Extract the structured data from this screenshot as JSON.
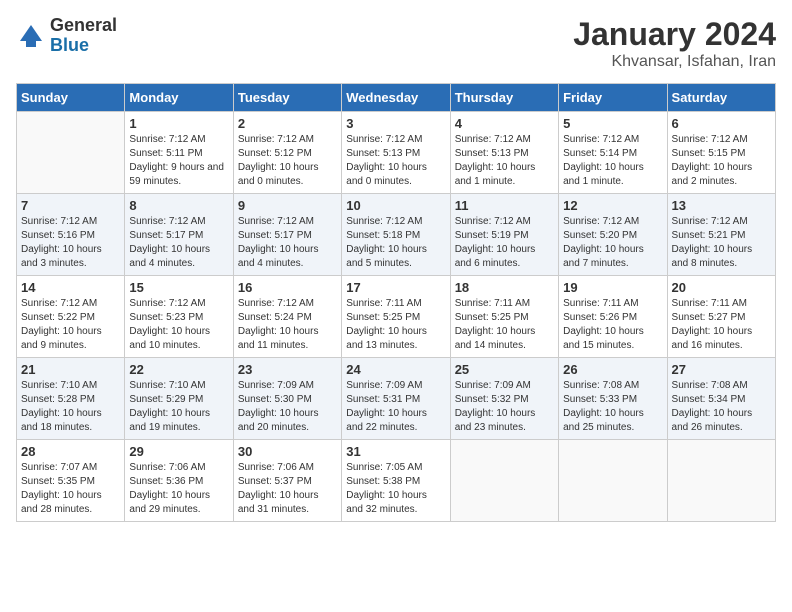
{
  "header": {
    "logo": {
      "line1": "General",
      "line2": "Blue"
    },
    "title": "January 2024",
    "subtitle": "Khvansar, Isfahan, Iran"
  },
  "days_of_week": [
    "Sunday",
    "Monday",
    "Tuesday",
    "Wednesday",
    "Thursday",
    "Friday",
    "Saturday"
  ],
  "weeks": [
    [
      {
        "day": "",
        "empty": true
      },
      {
        "day": "1",
        "sunrise": "7:12 AM",
        "sunset": "5:11 PM",
        "daylight": "9 hours and 59 minutes."
      },
      {
        "day": "2",
        "sunrise": "7:12 AM",
        "sunset": "5:12 PM",
        "daylight": "10 hours and 0 minutes."
      },
      {
        "day": "3",
        "sunrise": "7:12 AM",
        "sunset": "5:13 PM",
        "daylight": "10 hours and 0 minutes."
      },
      {
        "day": "4",
        "sunrise": "7:12 AM",
        "sunset": "5:13 PM",
        "daylight": "10 hours and 1 minute."
      },
      {
        "day": "5",
        "sunrise": "7:12 AM",
        "sunset": "5:14 PM",
        "daylight": "10 hours and 1 minute."
      },
      {
        "day": "6",
        "sunrise": "7:12 AM",
        "sunset": "5:15 PM",
        "daylight": "10 hours and 2 minutes."
      }
    ],
    [
      {
        "day": "7",
        "sunrise": "7:12 AM",
        "sunset": "5:16 PM",
        "daylight": "10 hours and 3 minutes."
      },
      {
        "day": "8",
        "sunrise": "7:12 AM",
        "sunset": "5:17 PM",
        "daylight": "10 hours and 4 minutes."
      },
      {
        "day": "9",
        "sunrise": "7:12 AM",
        "sunset": "5:17 PM",
        "daylight": "10 hours and 4 minutes."
      },
      {
        "day": "10",
        "sunrise": "7:12 AM",
        "sunset": "5:18 PM",
        "daylight": "10 hours and 5 minutes."
      },
      {
        "day": "11",
        "sunrise": "7:12 AM",
        "sunset": "5:19 PM",
        "daylight": "10 hours and 6 minutes."
      },
      {
        "day": "12",
        "sunrise": "7:12 AM",
        "sunset": "5:20 PM",
        "daylight": "10 hours and 7 minutes."
      },
      {
        "day": "13",
        "sunrise": "7:12 AM",
        "sunset": "5:21 PM",
        "daylight": "10 hours and 8 minutes."
      }
    ],
    [
      {
        "day": "14",
        "sunrise": "7:12 AM",
        "sunset": "5:22 PM",
        "daylight": "10 hours and 9 minutes."
      },
      {
        "day": "15",
        "sunrise": "7:12 AM",
        "sunset": "5:23 PM",
        "daylight": "10 hours and 10 minutes."
      },
      {
        "day": "16",
        "sunrise": "7:12 AM",
        "sunset": "5:24 PM",
        "daylight": "10 hours and 11 minutes."
      },
      {
        "day": "17",
        "sunrise": "7:11 AM",
        "sunset": "5:25 PM",
        "daylight": "10 hours and 13 minutes."
      },
      {
        "day": "18",
        "sunrise": "7:11 AM",
        "sunset": "5:25 PM",
        "daylight": "10 hours and 14 minutes."
      },
      {
        "day": "19",
        "sunrise": "7:11 AM",
        "sunset": "5:26 PM",
        "daylight": "10 hours and 15 minutes."
      },
      {
        "day": "20",
        "sunrise": "7:11 AM",
        "sunset": "5:27 PM",
        "daylight": "10 hours and 16 minutes."
      }
    ],
    [
      {
        "day": "21",
        "sunrise": "7:10 AM",
        "sunset": "5:28 PM",
        "daylight": "10 hours and 18 minutes."
      },
      {
        "day": "22",
        "sunrise": "7:10 AM",
        "sunset": "5:29 PM",
        "daylight": "10 hours and 19 minutes."
      },
      {
        "day": "23",
        "sunrise": "7:09 AM",
        "sunset": "5:30 PM",
        "daylight": "10 hours and 20 minutes."
      },
      {
        "day": "24",
        "sunrise": "7:09 AM",
        "sunset": "5:31 PM",
        "daylight": "10 hours and 22 minutes."
      },
      {
        "day": "25",
        "sunrise": "7:09 AM",
        "sunset": "5:32 PM",
        "daylight": "10 hours and 23 minutes."
      },
      {
        "day": "26",
        "sunrise": "7:08 AM",
        "sunset": "5:33 PM",
        "daylight": "10 hours and 25 minutes."
      },
      {
        "day": "27",
        "sunrise": "7:08 AM",
        "sunset": "5:34 PM",
        "daylight": "10 hours and 26 minutes."
      }
    ],
    [
      {
        "day": "28",
        "sunrise": "7:07 AM",
        "sunset": "5:35 PM",
        "daylight": "10 hours and 28 minutes."
      },
      {
        "day": "29",
        "sunrise": "7:06 AM",
        "sunset": "5:36 PM",
        "daylight": "10 hours and 29 minutes."
      },
      {
        "day": "30",
        "sunrise": "7:06 AM",
        "sunset": "5:37 PM",
        "daylight": "10 hours and 31 minutes."
      },
      {
        "day": "31",
        "sunrise": "7:05 AM",
        "sunset": "5:38 PM",
        "daylight": "10 hours and 32 minutes."
      },
      {
        "day": "",
        "empty": true
      },
      {
        "day": "",
        "empty": true
      },
      {
        "day": "",
        "empty": true
      }
    ]
  ],
  "labels": {
    "sunrise_prefix": "Sunrise: ",
    "sunset_prefix": "Sunset: ",
    "daylight_prefix": "Daylight: "
  }
}
